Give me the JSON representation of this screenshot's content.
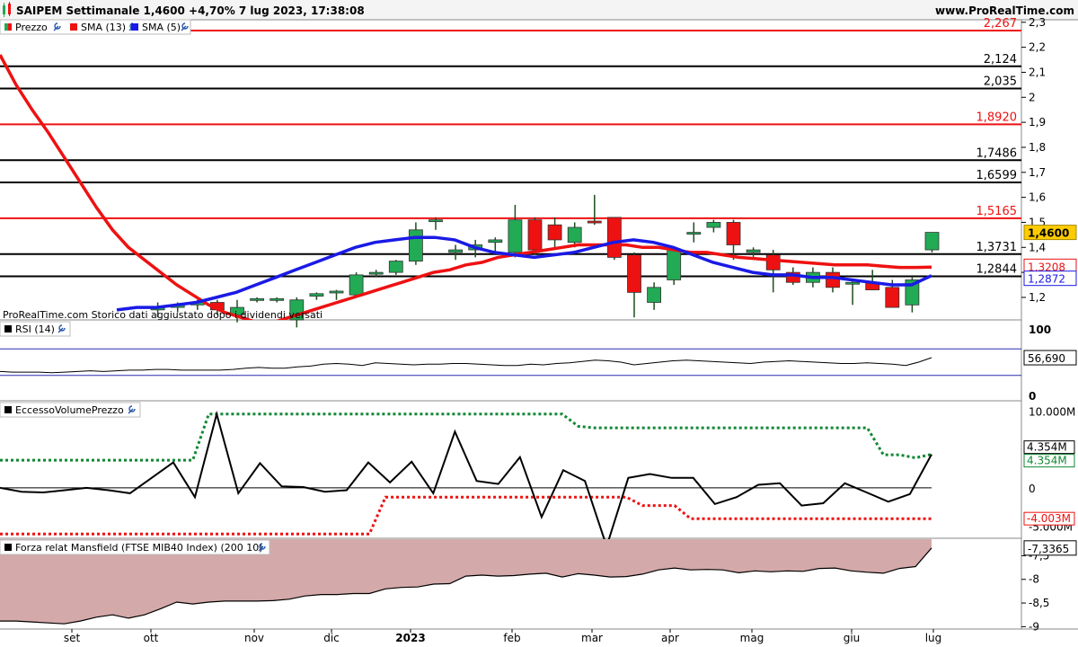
{
  "header": {
    "title": "SAIPEM Settimanale 1,4600 +4,70% 7 lug 2023, 17:38:08",
    "site": "www.ProRealTime.com"
  },
  "colors": {
    "up": "#22aa55",
    "down": "#ee1111",
    "sma13": "#ee1111",
    "sma5": "#1a1ae6",
    "level_red": "#ee1111",
    "level_black": "#000000",
    "price_tag": "#ffcc00",
    "mansfield_fill": "#d4a9a9"
  },
  "chart_data": [
    {
      "panel": "price",
      "type": "candlestick",
      "legend": [
        {
          "name": "Prezzo",
          "color": "#22aa55",
          "icon": "wrench-icon"
        },
        {
          "name": "SMA (13)",
          "color": "#ee1111",
          "icon": "wrench-icon"
        },
        {
          "name": "SMA (5)",
          "color": "#1a1ae6",
          "icon": "wrench-icon"
        }
      ],
      "note": "ProRealTime.com Storico dati aggiustato dopo i dividendi versati",
      "ylim": [
        1.11,
        2.31
      ],
      "y_ticks": [
        "1,2",
        "1,3",
        "1,4",
        "1,5",
        "1,6",
        "1,7",
        "1,8",
        "1,9",
        "2",
        "2,1",
        "2,2",
        "2,3"
      ],
      "last_price_label": "1,4600",
      "sma13_label": "1,3208",
      "sma5_label": "1,2872",
      "levels": [
        {
          "value": 2.267,
          "label": "2,267",
          "color": "#ee1111"
        },
        {
          "value": 2.124,
          "label": "2,124",
          "color": "#000000"
        },
        {
          "value": 2.035,
          "label": "2,035",
          "color": "#000000"
        },
        {
          "value": 1.892,
          "label": "1,8920",
          "color": "#ee1111"
        },
        {
          "value": 1.7486,
          "label": "1,7486",
          "color": "#000000"
        },
        {
          "value": 1.6599,
          "label": "1,6599",
          "color": "#000000"
        },
        {
          "value": 1.5165,
          "label": "1,5165",
          "color": "#ee1111"
        },
        {
          "value": 1.3731,
          "label": "1,3731",
          "color": "#000000"
        },
        {
          "value": 1.2844,
          "label": "1,2844",
          "color": "#000000"
        }
      ],
      "candles": [
        {
          "o": 1.15,
          "h": 1.18,
          "l": 1.12,
          "c": 1.16
        },
        {
          "o": 1.16,
          "h": 1.18,
          "l": 1.14,
          "c": 1.17
        },
        {
          "o": 1.17,
          "h": 1.19,
          "l": 1.15,
          "c": 1.18
        },
        {
          "o": 1.18,
          "h": 1.19,
          "l": 1.13,
          "c": 1.15
        },
        {
          "o": 1.13,
          "h": 1.19,
          "l": 1.1,
          "c": 1.16
        },
        {
          "o": 1.19,
          "h": 1.2,
          "l": 1.18,
          "c": 1.195
        },
        {
          "o": 1.19,
          "h": 1.2,
          "l": 1.18,
          "c": 1.195
        },
        {
          "o": 1.11,
          "h": 1.2,
          "l": 1.08,
          "c": 1.19
        },
        {
          "o": 1.205,
          "h": 1.22,
          "l": 1.19,
          "c": 1.215
        },
        {
          "o": 1.22,
          "h": 1.23,
          "l": 1.19,
          "c": 1.225
        },
        {
          "o": 1.21,
          "h": 1.3,
          "l": 1.2,
          "c": 1.29
        },
        {
          "o": 1.3,
          "h": 1.31,
          "l": 1.28,
          "c": 1.3
        },
        {
          "o": 1.3,
          "h": 1.35,
          "l": 1.29,
          "c": 1.345
        },
        {
          "o": 1.345,
          "h": 1.5,
          "l": 1.33,
          "c": 1.47
        },
        {
          "o": 1.505,
          "h": 1.52,
          "l": 1.47,
          "c": 1.51
        },
        {
          "o": 1.38,
          "h": 1.41,
          "l": 1.35,
          "c": 1.39
        },
        {
          "o": 1.39,
          "h": 1.43,
          "l": 1.36,
          "c": 1.41
        },
        {
          "o": 1.42,
          "h": 1.44,
          "l": 1.38,
          "c": 1.43
        },
        {
          "o": 1.38,
          "h": 1.57,
          "l": 1.36,
          "c": 1.51
        },
        {
          "o": 1.51,
          "h": 1.52,
          "l": 1.37,
          "c": 1.39
        },
        {
          "o": 1.49,
          "h": 1.52,
          "l": 1.4,
          "c": 1.43
        },
        {
          "o": 1.42,
          "h": 1.5,
          "l": 1.4,
          "c": 1.48
        },
        {
          "o": 1.505,
          "h": 1.61,
          "l": 1.49,
          "c": 1.5
        },
        {
          "o": 1.52,
          "h": 1.52,
          "l": 1.35,
          "c": 1.36
        },
        {
          "o": 1.37,
          "h": 1.38,
          "l": 1.12,
          "c": 1.22
        },
        {
          "o": 1.18,
          "h": 1.26,
          "l": 1.15,
          "c": 1.24
        },
        {
          "o": 1.27,
          "h": 1.4,
          "l": 1.25,
          "c": 1.39
        },
        {
          "o": 1.455,
          "h": 1.5,
          "l": 1.42,
          "c": 1.46
        },
        {
          "o": 1.48,
          "h": 1.51,
          "l": 1.46,
          "c": 1.5
        },
        {
          "o": 1.5,
          "h": 1.51,
          "l": 1.35,
          "c": 1.41
        },
        {
          "o": 1.38,
          "h": 1.4,
          "l": 1.36,
          "c": 1.39
        },
        {
          "o": 1.37,
          "h": 1.39,
          "l": 1.22,
          "c": 1.31
        },
        {
          "o": 1.3,
          "h": 1.32,
          "l": 1.25,
          "c": 1.26
        },
        {
          "o": 1.26,
          "h": 1.32,
          "l": 1.24,
          "c": 1.3
        },
        {
          "o": 1.3,
          "h": 1.32,
          "l": 1.22,
          "c": 1.24
        },
        {
          "o": 1.26,
          "h": 1.27,
          "l": 1.17,
          "c": 1.26
        },
        {
          "o": 1.26,
          "h": 1.31,
          "l": 1.23,
          "c": 1.23
        },
        {
          "o": 1.24,
          "h": 1.27,
          "l": 1.16,
          "c": 1.16
        },
        {
          "o": 1.17,
          "h": 1.28,
          "l": 1.14,
          "c": 1.27
        },
        {
          "o": 1.39,
          "h": 1.46,
          "l": 1.38,
          "c": 1.46
        }
      ],
      "sma13": [
        2.17,
        2.05,
        1.95,
        1.86,
        1.76,
        1.66,
        1.56,
        1.47,
        1.4,
        1.35,
        1.3,
        1.25,
        1.21,
        1.17,
        1.14,
        1.12,
        1.1,
        1.1,
        1.12,
        1.14,
        1.16,
        1.18,
        1.2,
        1.22,
        1.24,
        1.26,
        1.28,
        1.3,
        1.31,
        1.33,
        1.34,
        1.36,
        1.37,
        1.38,
        1.39,
        1.4,
        1.41,
        1.41,
        1.41,
        1.41,
        1.4,
        1.4,
        1.39,
        1.38,
        1.38,
        1.37,
        1.36,
        1.355,
        1.35,
        1.345,
        1.34,
        1.335,
        1.33,
        1.33,
        1.33,
        1.325,
        1.32,
        1.32,
        1.3208
      ],
      "sma5": [
        1.15,
        1.16,
        1.16,
        1.17,
        1.18,
        1.2,
        1.22,
        1.25,
        1.28,
        1.31,
        1.34,
        1.37,
        1.4,
        1.42,
        1.43,
        1.44,
        1.44,
        1.43,
        1.4,
        1.38,
        1.37,
        1.36,
        1.37,
        1.38,
        1.4,
        1.42,
        1.43,
        1.42,
        1.4,
        1.37,
        1.34,
        1.32,
        1.3,
        1.29,
        1.29,
        1.28,
        1.28,
        1.27,
        1.26,
        1.25,
        1.25,
        1.2872
      ]
    },
    {
      "panel": "rsi",
      "type": "line",
      "legend": {
        "name": "RSI (14)",
        "icon": "wrench-icon"
      },
      "ylim": [
        0,
        100
      ],
      "y_ticks": [
        "100",
        "0"
      ],
      "bands": [
        70,
        30
      ],
      "last_label": "56,690",
      "values": [
        36,
        35,
        35,
        35,
        34,
        35,
        36,
        37,
        36,
        37,
        38,
        38,
        39,
        39,
        38,
        38,
        38,
        38,
        39,
        41,
        42,
        41,
        41,
        43,
        44,
        47,
        48,
        47,
        45,
        49,
        48,
        47,
        46,
        47,
        47,
        48,
        48,
        47,
        46,
        45,
        45,
        47,
        46,
        48,
        49,
        51,
        53,
        52,
        50,
        46,
        48,
        50,
        52,
        53,
        52,
        51,
        50,
        49,
        48,
        50,
        51,
        52,
        51,
        50,
        49,
        48,
        48,
        49,
        48,
        47,
        45,
        50,
        56.69
      ]
    },
    {
      "panel": "volume",
      "type": "line",
      "legend": {
        "name": "EccessoVolumePrezzo",
        "icon": "wrench-icon"
      },
      "ylim": [
        -5500000,
        10500000
      ],
      "y_ticks": [
        "10.000M",
        "0",
        "-5.000M"
      ],
      "upper_label": "4.354M",
      "upper_label2": "4.354M",
      "lower_label": "-4.003M",
      "line": [
        0.0,
        -0.5,
        -0.6,
        -0.3,
        0.0,
        -0.3,
        -0.7,
        1.3,
        3.3,
        -1.2,
        9.6,
        -0.7,
        3.2,
        0.2,
        0.1,
        -0.5,
        -0.3,
        3.3,
        0.7,
        3.4,
        -0.7,
        7.3,
        0.9,
        0.5,
        4.0,
        -3.8,
        2.3,
        0.9,
        -7.6,
        1.3,
        1.8,
        1.3,
        1.3,
        -2.1,
        -1.2,
        0.4,
        0.6,
        -2.3,
        -2.0,
        0.6,
        -0.6,
        -1.8,
        -0.8,
        4.354
      ],
      "upper_band": [
        3.6,
        3.6,
        3.6,
        3.6,
        3.6,
        3.6,
        3.6,
        3.6,
        3.6,
        3.6,
        3.6,
        3.6,
        3.6,
        9.6,
        9.6,
        9.6,
        9.6,
        9.6,
        9.6,
        9.6,
        9.6,
        9.6,
        9.6,
        9.6,
        9.6,
        9.6,
        9.6,
        9.6,
        9.6,
        9.6,
        9.6,
        9.6,
        9.6,
        9.6,
        9.6,
        9.6,
        8.0,
        7.8,
        7.8,
        7.8,
        7.8,
        7.8,
        7.8,
        7.8,
        7.8,
        7.8,
        7.8,
        7.8,
        7.8,
        7.8,
        7.8,
        7.8,
        7.8,
        7.8,
        7.8,
        4.3,
        4.3,
        3.9,
        4.354
      ],
      "lower_band": [
        -6.0,
        -6.0,
        -6.0,
        -6.0,
        -6.0,
        -6.0,
        -6.0,
        -6.0,
        -6.0,
        -6.0,
        -6.0,
        -6.0,
        -6.0,
        -6.0,
        -6.0,
        -6.0,
        -6.0,
        -6.0,
        -6.0,
        -6.0,
        -6.0,
        -6.0,
        -6.0,
        -6.0,
        -1.2,
        -1.2,
        -1.2,
        -1.2,
        -1.2,
        -1.2,
        -1.2,
        -1.2,
        -1.2,
        -1.2,
        -1.2,
        -1.2,
        -1.2,
        -1.2,
        -1.2,
        -1.2,
        -2.3,
        -2.3,
        -2.3,
        -4.0,
        -4.0,
        -4.0,
        -4.0,
        -4.0,
        -4.0,
        -4.0,
        -4.0,
        -4.0,
        -4.0,
        -4.0,
        -4.0,
        -4.0,
        -4.0,
        -4.0,
        -4.003
      ]
    },
    {
      "panel": "mansfield",
      "type": "area",
      "legend": {
        "name": "Forza relat Mansfield (FTSE MIB40 Index) (200 10)",
        "icon": "wrench-icon"
      },
      "ylim": [
        -9.05,
        -7.15
      ],
      "y_ticks": [
        "-7,5",
        "-8",
        "-8,5",
        "-9"
      ],
      "last_label": "-7,3365",
      "values": [
        -8.88,
        -8.88,
        -8.9,
        -8.92,
        -8.94,
        -8.88,
        -8.8,
        -8.75,
        -8.82,
        -8.75,
        -8.62,
        -8.48,
        -8.52,
        -8.48,
        -8.46,
        -8.46,
        -8.46,
        -8.45,
        -8.42,
        -8.35,
        -8.32,
        -8.32,
        -8.3,
        -8.3,
        -8.2,
        -8.17,
        -8.16,
        -8.1,
        -8.09,
        -7.93,
        -7.91,
        -7.93,
        -7.92,
        -7.89,
        -7.87,
        -7.95,
        -7.88,
        -7.91,
        -7.95,
        -7.94,
        -7.89,
        -7.8,
        -7.76,
        -7.8,
        -7.79,
        -7.8,
        -7.86,
        -7.82,
        -7.84,
        -7.82,
        -7.83,
        -7.77,
        -7.76,
        -7.82,
        -7.85,
        -7.87,
        -7.77,
        -7.73,
        -7.3365
      ]
    }
  ],
  "x_axis": {
    "labels": [
      "set",
      "ott",
      "nov",
      "dic",
      "2023",
      "feb",
      "mar",
      "apr",
      "mag",
      "giu",
      "lug"
    ]
  }
}
